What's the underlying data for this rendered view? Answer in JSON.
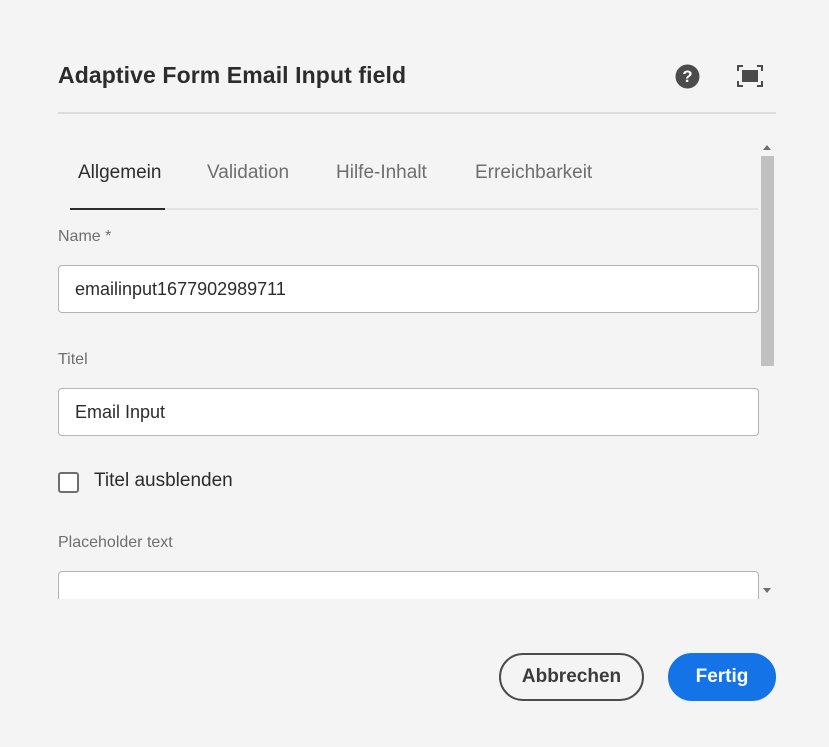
{
  "dialog": {
    "title": "Adaptive Form Email Input field",
    "icons": {
      "help": "help-circle-icon",
      "fullscreen": "fullscreen-icon"
    }
  },
  "tabs": [
    {
      "label": "Allgemein",
      "active": true
    },
    {
      "label": "Validation",
      "active": false
    },
    {
      "label": "Hilfe-Inhalt",
      "active": false
    },
    {
      "label": "Erreichbarkeit",
      "active": false
    }
  ],
  "fields": {
    "name": {
      "label": "Name *",
      "value": "emailinput1677902989711"
    },
    "title": {
      "label": "Titel",
      "value": "Email Input"
    },
    "hide_title": {
      "label": "Titel ausblenden",
      "checked": false
    },
    "placeholder": {
      "label": "Placeholder text",
      "value": ""
    }
  },
  "footer": {
    "cancel_label": "Abbrechen",
    "done_label": "Fertig"
  },
  "colors": {
    "background": "#f4f4f4",
    "accent": "#1473e6",
    "text": "#2c2c2c",
    "muted_text": "#6e6e6e"
  }
}
